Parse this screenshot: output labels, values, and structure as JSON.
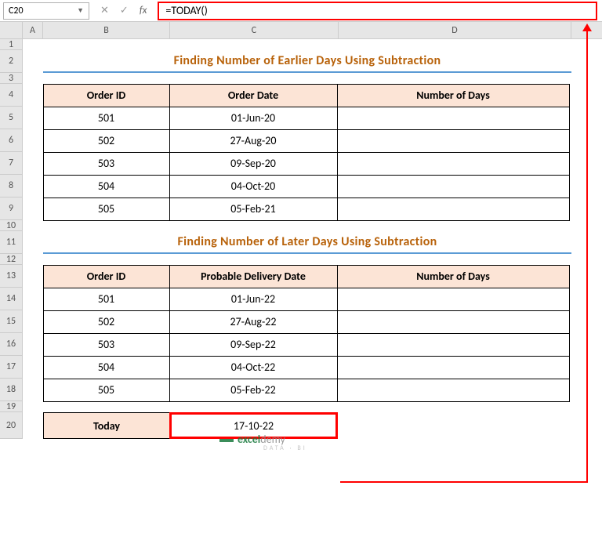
{
  "nameBox": {
    "value": "C20"
  },
  "formulaBar": {
    "value": "=TODAY()"
  },
  "columns": {
    "a": "A",
    "b": "B",
    "c": "C",
    "d": "D"
  },
  "rows": [
    "1",
    "2",
    "3",
    "4",
    "5",
    "6",
    "7",
    "8",
    "9",
    "10",
    "11",
    "12",
    "13",
    "14",
    "15",
    "16",
    "17",
    "18",
    "19",
    "20"
  ],
  "title1": "Finding Number of Earlier Days Using Subtraction",
  "table1": {
    "headers": {
      "b": "Order ID",
      "c": "Order Date",
      "d": "Number of Days"
    },
    "data": [
      {
        "b": "501",
        "c": "01-Jun-20",
        "d": ""
      },
      {
        "b": "502",
        "c": "27-Aug-20",
        "d": ""
      },
      {
        "b": "503",
        "c": "09-Sep-20",
        "d": ""
      },
      {
        "b": "504",
        "c": "04-Oct-20",
        "d": ""
      },
      {
        "b": "505",
        "c": "05-Feb-21",
        "d": ""
      }
    ]
  },
  "title2": "Finding Number of Later Days Using Subtraction",
  "table2": {
    "headers": {
      "b": "Order ID",
      "c": "Probable Delivery Date",
      "d": "Number of Days"
    },
    "data": [
      {
        "b": "501",
        "c": "01-Jun-22",
        "d": ""
      },
      {
        "b": "502",
        "c": "27-Aug-22",
        "d": ""
      },
      {
        "b": "503",
        "c": "09-Sep-22",
        "d": ""
      },
      {
        "b": "504",
        "c": "04-Oct-22",
        "d": ""
      },
      {
        "b": "505",
        "c": "05-Feb-22",
        "d": ""
      }
    ]
  },
  "todayRow": {
    "label": "Today",
    "value": "17-10-22"
  },
  "watermark": {
    "brand1": "excel",
    "brand2": "demy",
    "sub": "DATA · BI"
  }
}
